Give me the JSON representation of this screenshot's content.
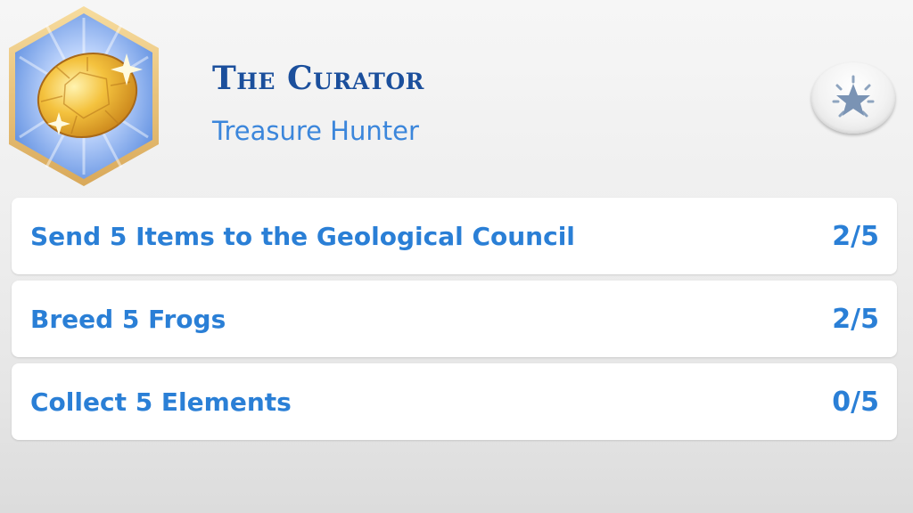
{
  "aspiration": {
    "title": "The Curator",
    "category": "Treasure Hunter",
    "badge_icon": "golden-gem-icon",
    "action_icon": "star-burst-icon"
  },
  "goals": [
    {
      "label": "Send 5 Items to the Geological Council",
      "progress": "2/5",
      "current": 2,
      "total": 5
    },
    {
      "label": "Breed 5 Frogs",
      "progress": "2/5",
      "current": 2,
      "total": 5
    },
    {
      "label": "Collect 5 Elements",
      "progress": "0/5",
      "current": 0,
      "total": 5
    }
  ],
  "colors": {
    "title": "#1b4f9c",
    "accent": "#2a7fd6",
    "badge_border": "#e8c27a",
    "gem": "#f0b32a"
  }
}
